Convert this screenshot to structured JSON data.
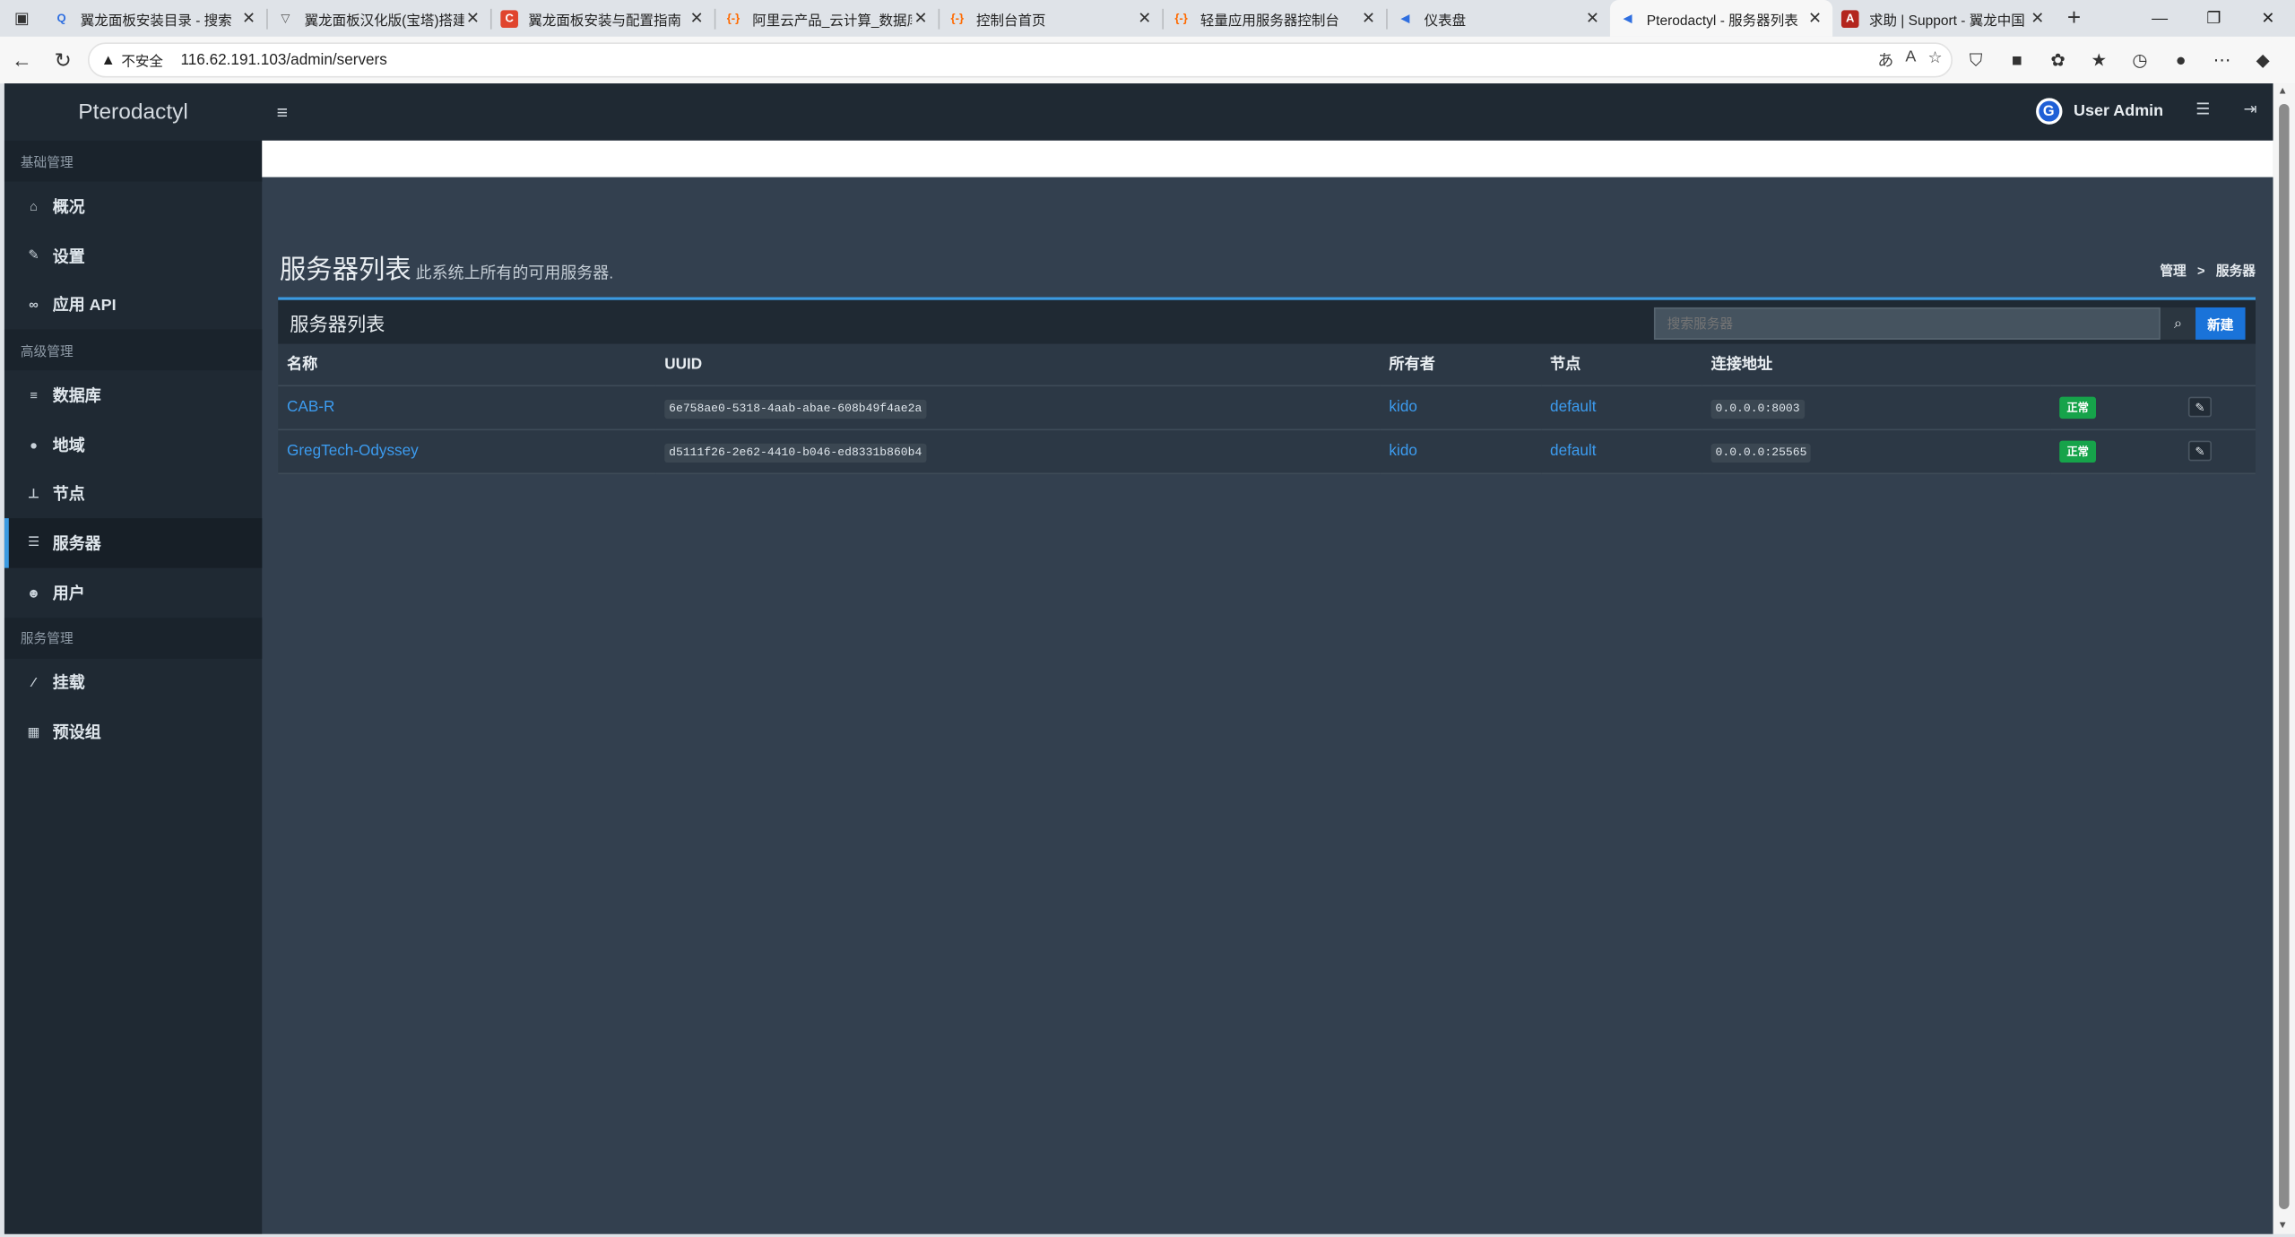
{
  "browser": {
    "tabs": [
      {
        "title": "翼龙面板安装目录 - 搜索",
        "fav": "Q",
        "fav_color": "#2f6fe0",
        "fav_bg": "transparent"
      },
      {
        "title": "翼龙面板汉化版(宝塔)搭建",
        "fav": "▽",
        "fav_color": "#555",
        "fav_bg": "transparent"
      },
      {
        "title": "翼龙面板安装与配置指南",
        "fav": "C",
        "fav_color": "#fff",
        "fav_bg": "#e0452e"
      },
      {
        "title": "阿里云产品_云计算_数据库",
        "fav": "{-}",
        "fav_color": "#ff6a00",
        "fav_bg": "transparent"
      },
      {
        "title": "控制台首页",
        "fav": "{-}",
        "fav_color": "#ff6a00",
        "fav_bg": "transparent"
      },
      {
        "title": "轻量应用服务器控制台",
        "fav": "{-}",
        "fav_color": "#ff6a00",
        "fav_bg": "transparent"
      },
      {
        "title": "仪表盘",
        "fav": "◀",
        "fav_color": "#2f6fe0",
        "fav_bg": "transparent"
      },
      {
        "title": "Pterodactyl - 服务器列表",
        "fav": "◀",
        "fav_color": "#2f6fe0",
        "fav_bg": "transparent",
        "active": true
      },
      {
        "title": "求助 | Support - 翼龙中国",
        "fav": "A",
        "fav_color": "#fff",
        "fav_bg": "#b3261e"
      }
    ],
    "insecure_label": "不安全",
    "url": "116.62.191.103/admin/servers"
  },
  "app": {
    "brand": "Pterodactyl",
    "user_name": "User Admin",
    "avatar_letter": "G"
  },
  "sidebar": {
    "sections": [
      {
        "header": "基础管理",
        "items": [
          {
            "label": "概况",
            "icon": "home-icon",
            "glyph": "⌂"
          },
          {
            "label": "设置",
            "icon": "wrench-icon",
            "glyph": "✎"
          },
          {
            "label": "应用 API",
            "icon": "link-icon",
            "glyph": "∞"
          }
        ]
      },
      {
        "header": "高级管理",
        "items": [
          {
            "label": "数据库",
            "icon": "database-icon",
            "glyph": "≡"
          },
          {
            "label": "地域",
            "icon": "globe-icon",
            "glyph": "●"
          },
          {
            "label": "节点",
            "icon": "sitemap-icon",
            "glyph": "⊥"
          },
          {
            "label": "服务器",
            "icon": "server-icon",
            "glyph": "☰",
            "active": true
          },
          {
            "label": "用户",
            "icon": "users-icon",
            "glyph": "☻"
          }
        ]
      },
      {
        "header": "服务管理",
        "items": [
          {
            "label": "挂载",
            "icon": "magic-icon",
            "glyph": "⁄"
          },
          {
            "label": "预设组",
            "icon": "th-large-icon",
            "glyph": "▦"
          }
        ]
      }
    ]
  },
  "page": {
    "title": "服务器列表",
    "subtitle": "此系统上所有的可用服务器.",
    "breadcrumb": [
      "管理",
      ">",
      "服务器"
    ]
  },
  "servers_box": {
    "title": "服务器列表",
    "search_placeholder": "搜索服务器",
    "new_label": "新建",
    "columns": [
      "名称",
      "UUID",
      "所有者",
      "节点",
      "连接地址",
      "",
      ""
    ],
    "rows": [
      {
        "name": "CAB-R",
        "uuid": "6e758ae0-5318-4aab-abae-608b49f4ae2a",
        "owner": "kido",
        "node": "default",
        "address": "0.0.0.0:8003",
        "status": "正常"
      },
      {
        "name": "GregTech-Odyssey",
        "uuid": "d5111f26-2e62-4410-b046-ed8331b860b4",
        "owner": "kido",
        "node": "default",
        "address": "0.0.0.0:25565",
        "status": "正常"
      }
    ]
  },
  "colors": {
    "accent": "#3b9ae1",
    "link": "#3c9cf0",
    "status_ok": "#16a34a",
    "new_button": "#1a73d9",
    "sidebar_bg": "#1f2933",
    "content_bg": "#33404f"
  }
}
